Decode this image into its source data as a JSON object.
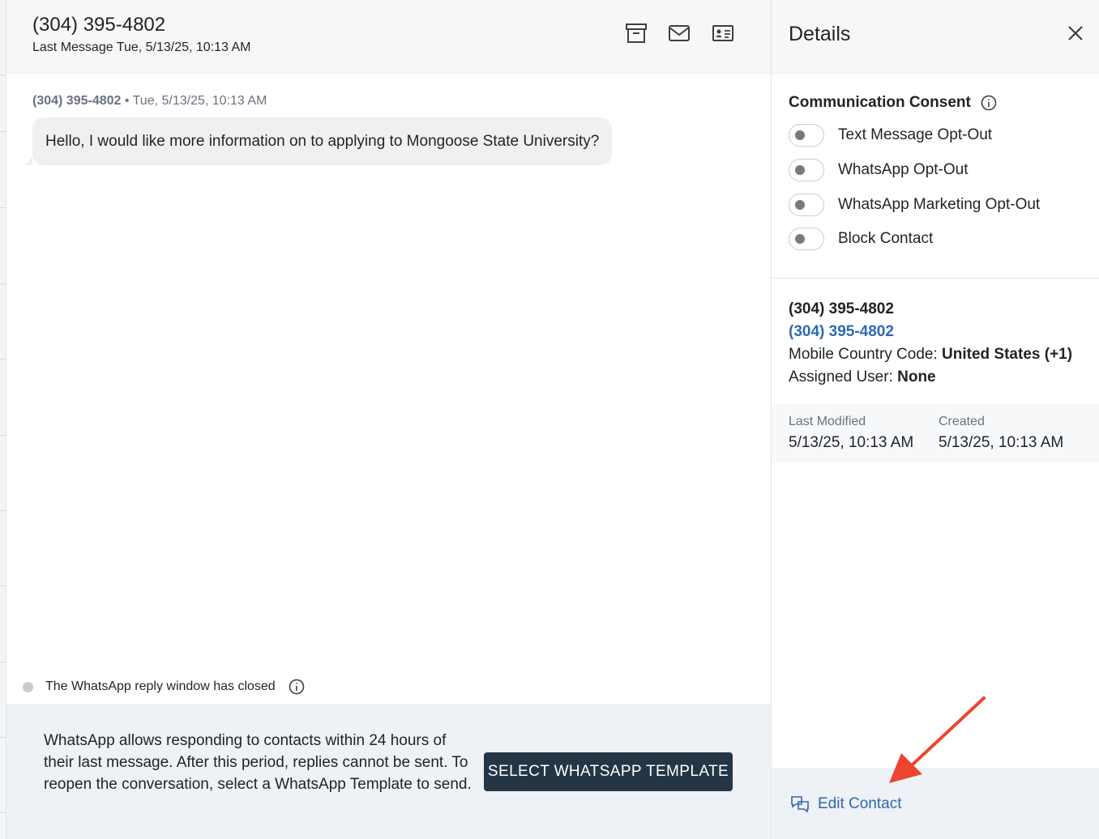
{
  "conversation": {
    "title": "(304) 395-4802",
    "subtitle": "Last Message Tue, 5/13/25, 10:13 AM",
    "header_icons": [
      "archive-icon",
      "envelope-icon",
      "contact-card-icon"
    ],
    "message": {
      "sender": "(304) 395-4802",
      "timestamp": " • Tue, 5/13/25, 10:13 AM",
      "text": "Hello, I would like more information on to applying to Mongoose State University?"
    },
    "notice": "The WhatsApp reply window has closed",
    "footer_text": "WhatsApp allows responding to contacts within 24 hours of their last message. After this period, replies cannot be sent. To reopen the conversation, select a WhatsApp Template to send.",
    "template_button": "SELECT WHATSAPP TEMPLATE"
  },
  "details": {
    "title": "Details",
    "consent": {
      "heading": "Communication Consent",
      "toggles": [
        {
          "label": "Text Message Opt-Out",
          "on": false
        },
        {
          "label": "WhatsApp Opt-Out",
          "on": false
        },
        {
          "label": "WhatsApp Marketing Opt-Out",
          "on": false
        },
        {
          "label": "Block Contact",
          "on": false
        }
      ]
    },
    "contact": {
      "name": "(304) 395-4802",
      "phone_link": "(304) 395-4802",
      "country_code_label": "Mobile Country Code: ",
      "country_code_value": "United States (+1)",
      "assigned_user_label": "Assigned User: ",
      "assigned_user_value": "None"
    },
    "dates": {
      "last_modified_label": "Last Modified",
      "last_modified_value": "5/13/25, 10:13 AM",
      "created_label": "Created",
      "created_value": "5/13/25, 10:13 AM"
    },
    "edit_contact_label": "Edit Contact"
  },
  "colors": {
    "accent_link": "#2e6ab0",
    "button_dark": "#243645",
    "annotation_arrow": "#ee4530"
  }
}
